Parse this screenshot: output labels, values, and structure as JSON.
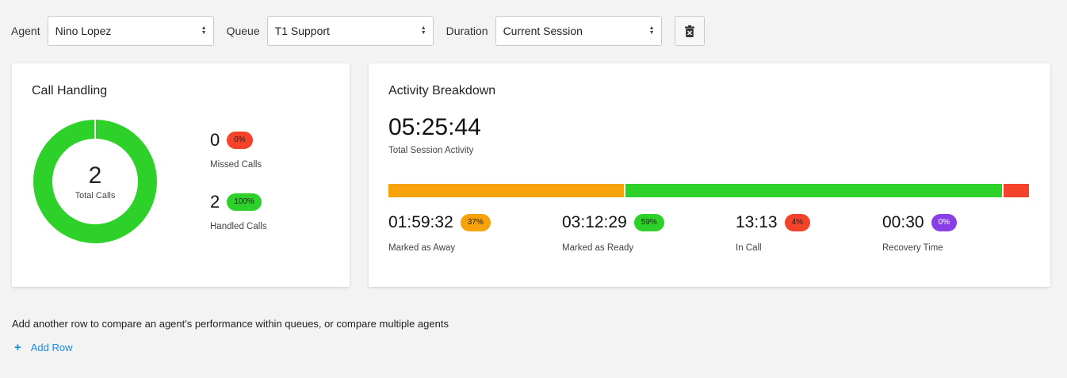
{
  "filters": {
    "agent_label": "Agent",
    "agent_value": "Nino Lopez",
    "queue_label": "Queue",
    "queue_value": "T1 Support",
    "duration_label": "Duration",
    "duration_value": "Current Session",
    "clear_icon": "trash-icon"
  },
  "call_handling": {
    "title": "Call Handling",
    "total": "2",
    "total_label": "Total Calls",
    "missed": {
      "value": "0",
      "badge": "0%",
      "label": "Missed Calls",
      "color": "#f5432a",
      "fraction": 0
    },
    "handled": {
      "value": "2",
      "badge": "100%",
      "label": "Handled Calls",
      "color": "#2ed12a",
      "fraction": 1
    }
  },
  "activity": {
    "title": "Activity Breakdown",
    "total_time": "05:25:44",
    "total_label": "Total Session Activity",
    "items": [
      {
        "time": "01:59:32",
        "badge": "37%",
        "label": "Marked as Away",
        "color": "#f7a20b",
        "fraction": 0.37
      },
      {
        "time": "03:12:29",
        "badge": "59%",
        "label": "Marked as Ready",
        "color": "#2ed12a",
        "fraction": 0.59
      },
      {
        "time": "13:13",
        "badge": "4%",
        "label": "In Call",
        "color": "#f5432a",
        "fraction": 0.04
      },
      {
        "time": "00:30",
        "badge": "0%",
        "label": "Recovery Time",
        "color": "#8a3fe6",
        "fraction": 0.0
      }
    ]
  },
  "footer": {
    "hint": "Add another row to compare an agent's performance within queues, or compare multiple agents",
    "add_row_label": "Add Row",
    "add_icon": "plus-icon"
  }
}
